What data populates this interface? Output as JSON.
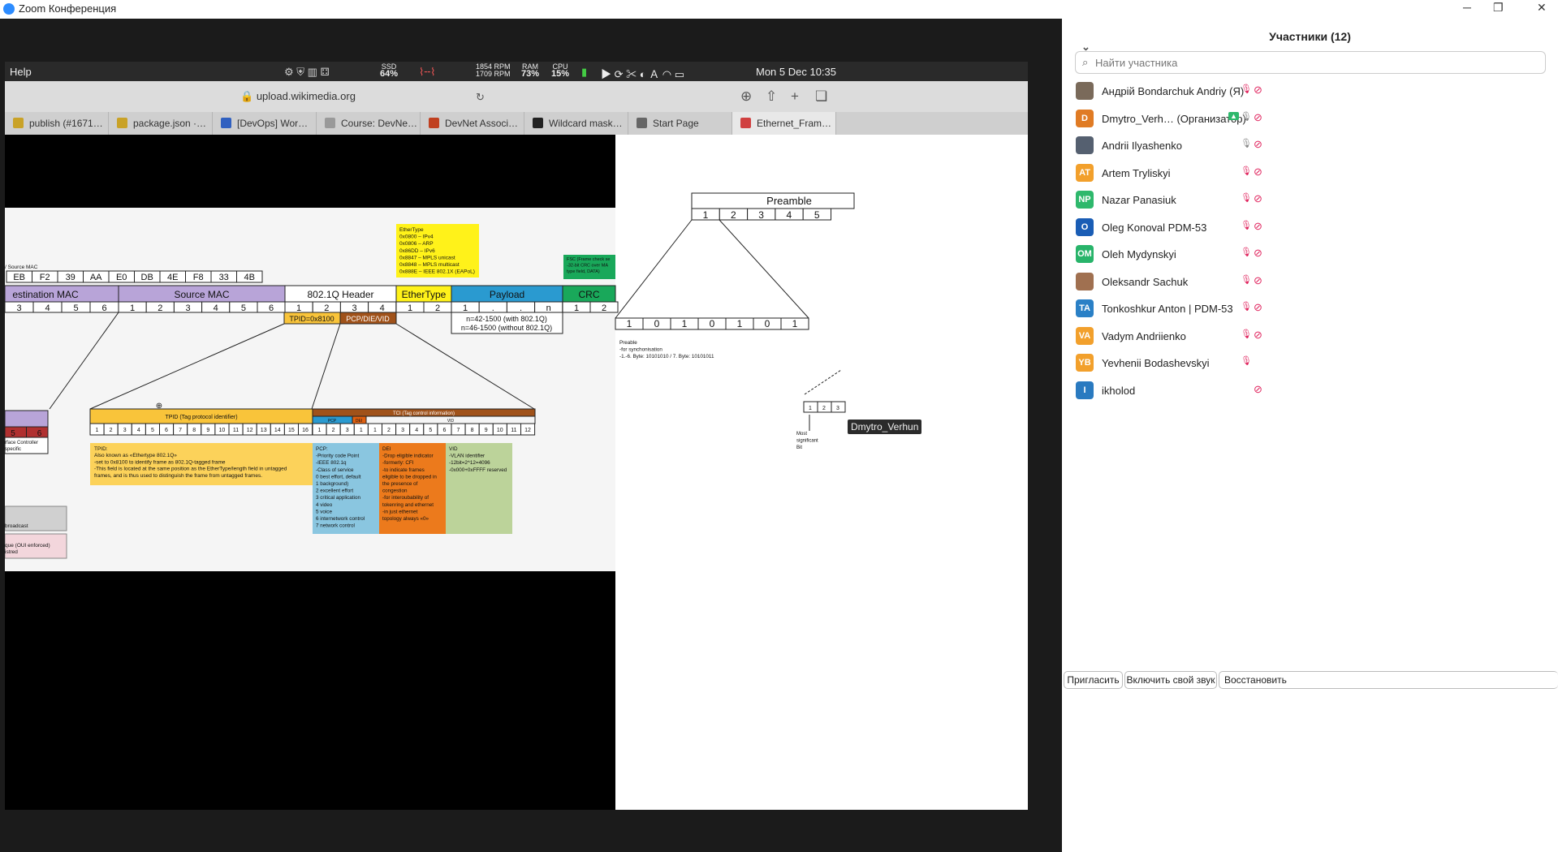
{
  "window": {
    "title": "Zoom Конференция"
  },
  "macbar": {
    "help": "Help",
    "ssd_label": "SSD",
    "ssd": "64%",
    "rpm1": "1854 RPM",
    "rpm2": "1709 RPM",
    "ram_label": "RAM",
    "ram": "73%",
    "cpu_label": "CPU",
    "cpu": "15%",
    "datetime": "Mon 5 Dec  10:35"
  },
  "browser": {
    "url": "upload.wikimedia.org",
    "tabs": [
      {
        "label": "publish (#1671…"
      },
      {
        "label": "package.json ·…"
      },
      {
        "label": "[DevOps] Wor…"
      },
      {
        "label": "Course: DevNe…"
      },
      {
        "label": "DevNet Associ…"
      },
      {
        "label": "Wildcard mask…"
      },
      {
        "label": "Start Page"
      },
      {
        "label": "Ethernet_Fram…"
      }
    ]
  },
  "diagram": {
    "ethertype_box": [
      "EtherType",
      "0x0800 – IPv4",
      "0x0806 – ARP",
      "0x86DD – IPv6",
      "0x8847 – MPLS unicast",
      "0x8848 – MPLS multicast",
      "0x888E – IEEE 802.1X (EAPoL)"
    ],
    "fcs_box": [
      "FSC (Frame check se",
      "-32-bit CRC over MA",
      "type field, DATA)"
    ],
    "source_mac_caption": "/ Source MAC",
    "mac_bytes": [
      "EB",
      "F2",
      "39",
      "AA",
      "E0",
      "DB",
      "4E",
      "F8",
      "33",
      "4B"
    ],
    "fields": [
      "estination MAC",
      "Source MAC",
      "802.1Q Header",
      "EtherType",
      "Payload",
      "CRC"
    ],
    "numbers_dmac": [
      "3",
      "4",
      "5",
      "6"
    ],
    "numbers_smac": [
      "1",
      "2",
      "3",
      "4",
      "5",
      "6"
    ],
    "numbers_q": [
      "1",
      "2",
      "3",
      "4"
    ],
    "numbers_et": [
      "1",
      "2"
    ],
    "payload_nums": [
      "1",
      ".",
      ".",
      "n"
    ],
    "crc_nums": [
      "1",
      "2"
    ],
    "tpid": "TPID=0x8100",
    "pcp_die_vid": "PCP/DIE/VID",
    "payload_note1": "n=42-1500 (with 802.1Q)",
    "payload_note2": "n=46-1500 (without 802.1Q)",
    "tpid_long": "TPID (Tag protocol identifier)",
    "tci_long": "TCI (Tag control information)",
    "pcp_s": "PCP",
    "dei_s": "DEI",
    "vid_s": "VID",
    "bits16": [
      "1",
      "2",
      "3",
      "4",
      "5",
      "6",
      "7",
      "8",
      "9",
      "10",
      "11",
      "12",
      "13",
      "14",
      "15",
      "16"
    ],
    "bits_pcp": [
      "1",
      "2",
      "3"
    ],
    "bits_dei": [
      "1"
    ],
    "bits_vid": [
      "1",
      "2",
      "3",
      "4",
      "5",
      "6",
      "7",
      "8",
      "9",
      "10",
      "11",
      "12"
    ],
    "tpid_desc": [
      "TPID:",
      "Also known as «Ethertype 802.1Q»",
      "-set to 0x8100 to identify frame as 802.1Q-tagged frame",
      "-This field is located at the same position as the EtherType/length field in untagged",
      "frames, and is thus used to distinguish the frame from untagged frames."
    ],
    "pcp_desc": [
      "PCP:",
      "-Priority code Point",
      "-IEEE 802.1q",
      "-Class of service",
      "0  best effort, default",
      "1  background)",
      "2  excellent effort",
      "3  critical application",
      "4  video",
      "5  voice",
      "6  internetwork control",
      "7  network control"
    ],
    "dei_desc": [
      "DEI",
      "-Drop eligible indicator",
      "-formerly: CFI",
      "-to indicate frames",
      "eligible to be dropped in",
      "the presence of",
      "congestion",
      "-for interoubability of",
      "tokenring and ethernet",
      "-in just ethernet",
      "topology always «0»"
    ],
    "vid_desc": [
      "VID",
      "-VLAN identifier",
      "-12bit=2^12=4096",
      "-0x000+0xFFFF reserved"
    ],
    "left_nums": [
      "5",
      "6"
    ],
    "left_caption": [
      "rface Controller",
      "specific"
    ],
    "broadcast": "broadcast",
    "oui": [
      "que (OUI enforced)",
      "istred"
    ],
    "preamble_title": "Preamble",
    "preamble_nums": [
      "1",
      "2",
      "3",
      "4",
      "5"
    ],
    "preamble_bits": [
      "1",
      "0",
      "1",
      "0",
      "1",
      "0",
      "1"
    ],
    "preamble_desc": [
      "Preable",
      "-for synchonisation",
      "-1.-6. Byte: 10101010 / 7. Byte: 10101011"
    ],
    "sfd_nums": [
      "1",
      "2",
      "3"
    ],
    "msb": [
      "Most",
      "significant",
      "Bit"
    ]
  },
  "speaker": {
    "name": "Dmytro_Verhun",
    "tooltip": "Dmytro_Verhun"
  },
  "panel": {
    "title": "Участники (12)",
    "search_placeholder": "Найти участника",
    "participants": [
      {
        "name": "Андрій Bondarchuk Andriy (Я)",
        "initials": "",
        "color": "#7a6a5a",
        "photo": true,
        "mic": "muted",
        "cam": "off"
      },
      {
        "name": "Dmytro_Verh…  (Организатор)",
        "initials": "D",
        "color": "#e07b24",
        "mic": "on",
        "cam": "off",
        "share": true
      },
      {
        "name": "Andrii Ilyashenko",
        "initials": "",
        "color": "#556070",
        "photo": true,
        "mic": "on",
        "cam": "off"
      },
      {
        "name": "Artem Tryliskyi",
        "initials": "AT",
        "color": "#f2a02c",
        "mic": "muted",
        "cam": "off"
      },
      {
        "name": "Nazar Panasiuk",
        "initials": "NP",
        "color": "#2eb86c",
        "mic": "muted",
        "cam": "off"
      },
      {
        "name": "Oleg Konoval PDM-53",
        "initials": "O",
        "color": "#1a5db5",
        "mic": "muted",
        "cam": "off"
      },
      {
        "name": "Oleh Mydynskyi",
        "initials": "OM",
        "color": "#28b46a",
        "mic": "muted",
        "cam": "off"
      },
      {
        "name": "Oleksandr Sachuk",
        "initials": "",
        "color": "#a07050",
        "photo": true,
        "mic": "muted",
        "cam": "off"
      },
      {
        "name": "Tonkoshkur Anton | PDM-53",
        "initials": "TA",
        "color": "#2a80c6",
        "mic": "muted",
        "cam": "off"
      },
      {
        "name": "Vadym Andriienko",
        "initials": "VA",
        "color": "#f2a02c",
        "mic": "muted",
        "cam": "off"
      },
      {
        "name": "Yevhenii Bodashevskyi",
        "initials": "YB",
        "color": "#f2a02c",
        "mic": "muted",
        "cam": "none"
      },
      {
        "name": "ikholod",
        "initials": "I",
        "color": "#2a7ac0",
        "mic": "none",
        "cam": "off"
      }
    ],
    "buttons": {
      "invite": "Пригласить",
      "unmute": "Включить свой звук",
      "restore": "Восстановить"
    }
  }
}
